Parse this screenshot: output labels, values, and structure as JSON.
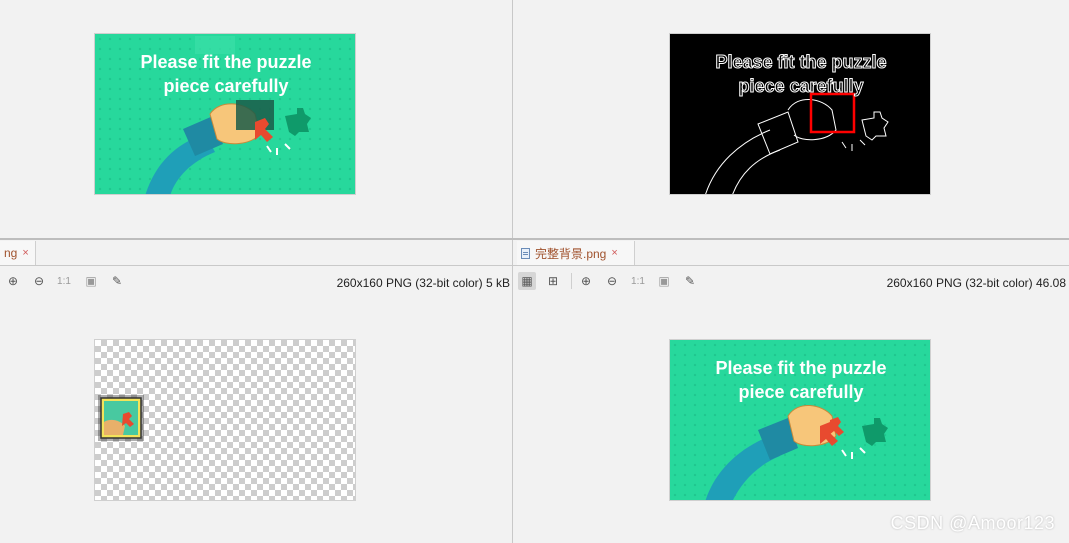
{
  "panes": {
    "top_left": {
      "caption_line1": "Please fit the puzzle",
      "caption_line2": "piece carefully"
    },
    "top_right": {
      "caption_line1": "Please fit the puzzle",
      "caption_line2": "piece carefully"
    },
    "bottom_left": {
      "tab_label": "ng",
      "tab_close": "×",
      "zoom_ratio": "1:1",
      "image_info": "260x160 PNG (32-bit color) 5 kB"
    },
    "bottom_right": {
      "tab_label": "完整背景.png",
      "tab_close": "×",
      "zoom_ratio": "1:1",
      "image_info": "260x160 PNG (32-bit color) 46.08",
      "caption_line1": "Please fit the puzzle",
      "caption_line2": "piece carefully"
    }
  },
  "icons": {
    "zoom_in": "⊕",
    "zoom_out": "⊖",
    "fit": "▣",
    "color_picker": "✎",
    "checker_toggle": "▦",
    "grid": "⊞"
  },
  "colors": {
    "background_green": "#27d89c",
    "hand_skin": "#f7c67a",
    "sleeve": "#1f9fb8",
    "puzzle_red": "#e84a2f",
    "puzzle_dark_green": "#0f9a6a",
    "match_box": "#ff0000"
  },
  "watermark": "CSDN @Amoor123"
}
